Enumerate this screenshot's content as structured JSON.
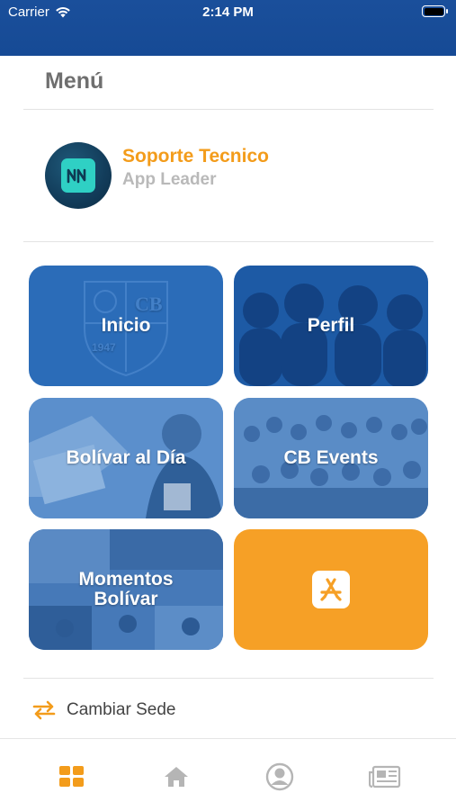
{
  "status_bar": {
    "carrier": "Carrier",
    "time": "2:14 PM"
  },
  "menu": {
    "title": "Menú"
  },
  "profile": {
    "name": "Soporte Tecnico",
    "role": "App Leader"
  },
  "tiles": [
    {
      "label": "Inicio"
    },
    {
      "label": "Perfil"
    },
    {
      "label": "Bolívar al Día"
    },
    {
      "label": "CB Events"
    },
    {
      "label_line1": "Momentos",
      "label_line2": "Bolívar"
    },
    {
      "icon": "app-store-icon"
    }
  ],
  "sede": {
    "label": "Cambiar Sede",
    "icon": "swap-arrows-icon"
  },
  "tab_bar": {
    "items": [
      {
        "icon": "grid-icon",
        "active": true
      },
      {
        "icon": "home-icon",
        "active": false
      },
      {
        "icon": "user-icon",
        "active": false
      },
      {
        "icon": "news-icon",
        "active": false
      }
    ]
  },
  "colors": {
    "header_blue": "#1a4f9b",
    "accent_orange": "#f39c1b",
    "tile_blue": "#2b6cb8",
    "tab_inactive": "#b5b5b5"
  }
}
